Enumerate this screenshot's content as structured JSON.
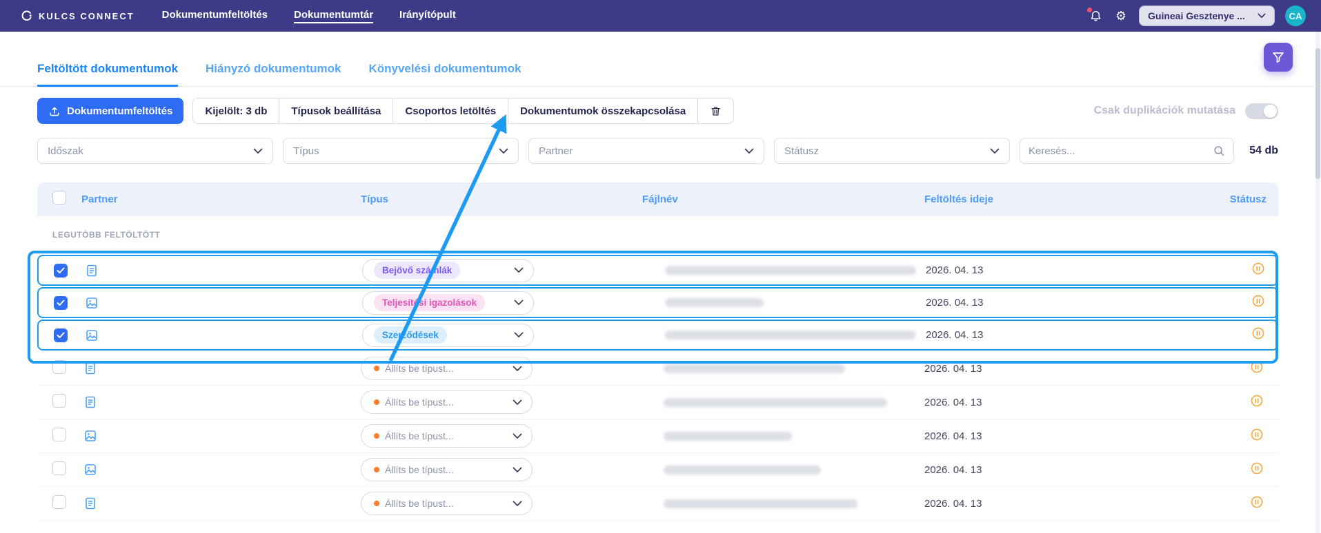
{
  "colors": {
    "navbar_bg": "#3d3a87",
    "primary_blue": "#2e6cf3",
    "tab_active_blue": "#1b86f8",
    "header_text_blue": "#4e9cf6",
    "annotation_blue": "#1c9bf0",
    "status_orange": "#f5a83c",
    "unset_dot_orange": "#ff7b2e",
    "fab_purple": "#6e58d8",
    "avatar_teal": "#1ab5c9"
  },
  "navbar": {
    "brand": "KULCS CONNECT",
    "items": [
      {
        "label": "Dokumentumfeltöltés",
        "active": false
      },
      {
        "label": "Dokumentumtár",
        "active": true
      },
      {
        "label": "Irányítópult",
        "active": false
      }
    ],
    "company_selector": {
      "label": "Guineai Gesztenye ..."
    },
    "avatar": "CA"
  },
  "tabs": [
    {
      "label": "Feltöltött dokumentumok",
      "active": true
    },
    {
      "label": "Hiányzó dokumentumok",
      "active": false
    },
    {
      "label": "Könyvelési dokumentumok",
      "active": false
    }
  ],
  "toolbar": {
    "upload_button": "Dokumentumfeltöltés",
    "group": [
      "Kijelölt: 3 db",
      "Típusok beállítása",
      "Csoportos letöltés",
      "Dokumentumok összekapcsolása"
    ],
    "duplicates_toggle": {
      "label": "Csak duplikációk mutatása",
      "on": false
    }
  },
  "filters": {
    "dropdowns": [
      "Időszak",
      "Típus",
      "Partner",
      "Státusz"
    ],
    "search_placeholder": "Keresés...",
    "result_count": "54 db"
  },
  "table": {
    "headers": {
      "partner": "Partner",
      "type": "Típus",
      "filename": "Fájlnév",
      "uploaded": "Feltöltés ideje",
      "status": "Státusz"
    },
    "section_label": "LEGUTÓBB FELTÖLTÖTT",
    "rows": [
      {
        "selected": true,
        "icon": "file",
        "type_badge": {
          "label": "Bejövő számlák",
          "theme": "purple"
        },
        "file_blur_width": 364,
        "date": "2026. 04. 13",
        "status": "pending"
      },
      {
        "selected": true,
        "icon": "image",
        "type_badge": {
          "label": "Teljesítési igazolások",
          "theme": "pink"
        },
        "file_blur_width": 143,
        "date": "2026. 04. 13",
        "status": "pending"
      },
      {
        "selected": true,
        "icon": "image",
        "type_badge": {
          "label": "Szerződések",
          "theme": "blue"
        },
        "file_blur_width": 364,
        "date": "2026. 04. 13",
        "status": "pending"
      },
      {
        "selected": false,
        "icon": "file",
        "type_placeholder": "Állíts be típust...",
        "file_blur_width": 263,
        "date": "2026. 04. 13",
        "status": "pending"
      },
      {
        "selected": false,
        "icon": "file",
        "type_placeholder": "Állíts be típust...",
        "file_blur_width": 324,
        "date": "2026. 04. 13",
        "status": "pending"
      },
      {
        "selected": false,
        "icon": "image",
        "type_placeholder": "Állíts be típust...",
        "file_blur_width": 186,
        "date": "2026. 04. 13",
        "status": "pending"
      },
      {
        "selected": false,
        "icon": "image",
        "type_placeholder": "Állíts be típust...",
        "file_blur_width": 228,
        "date": "2026. 04. 13",
        "status": "pending"
      },
      {
        "selected": false,
        "icon": "file",
        "type_placeholder": "Állíts be típust...",
        "file_blur_width": 281,
        "date": "2026. 04. 13",
        "status": "pending"
      }
    ]
  }
}
